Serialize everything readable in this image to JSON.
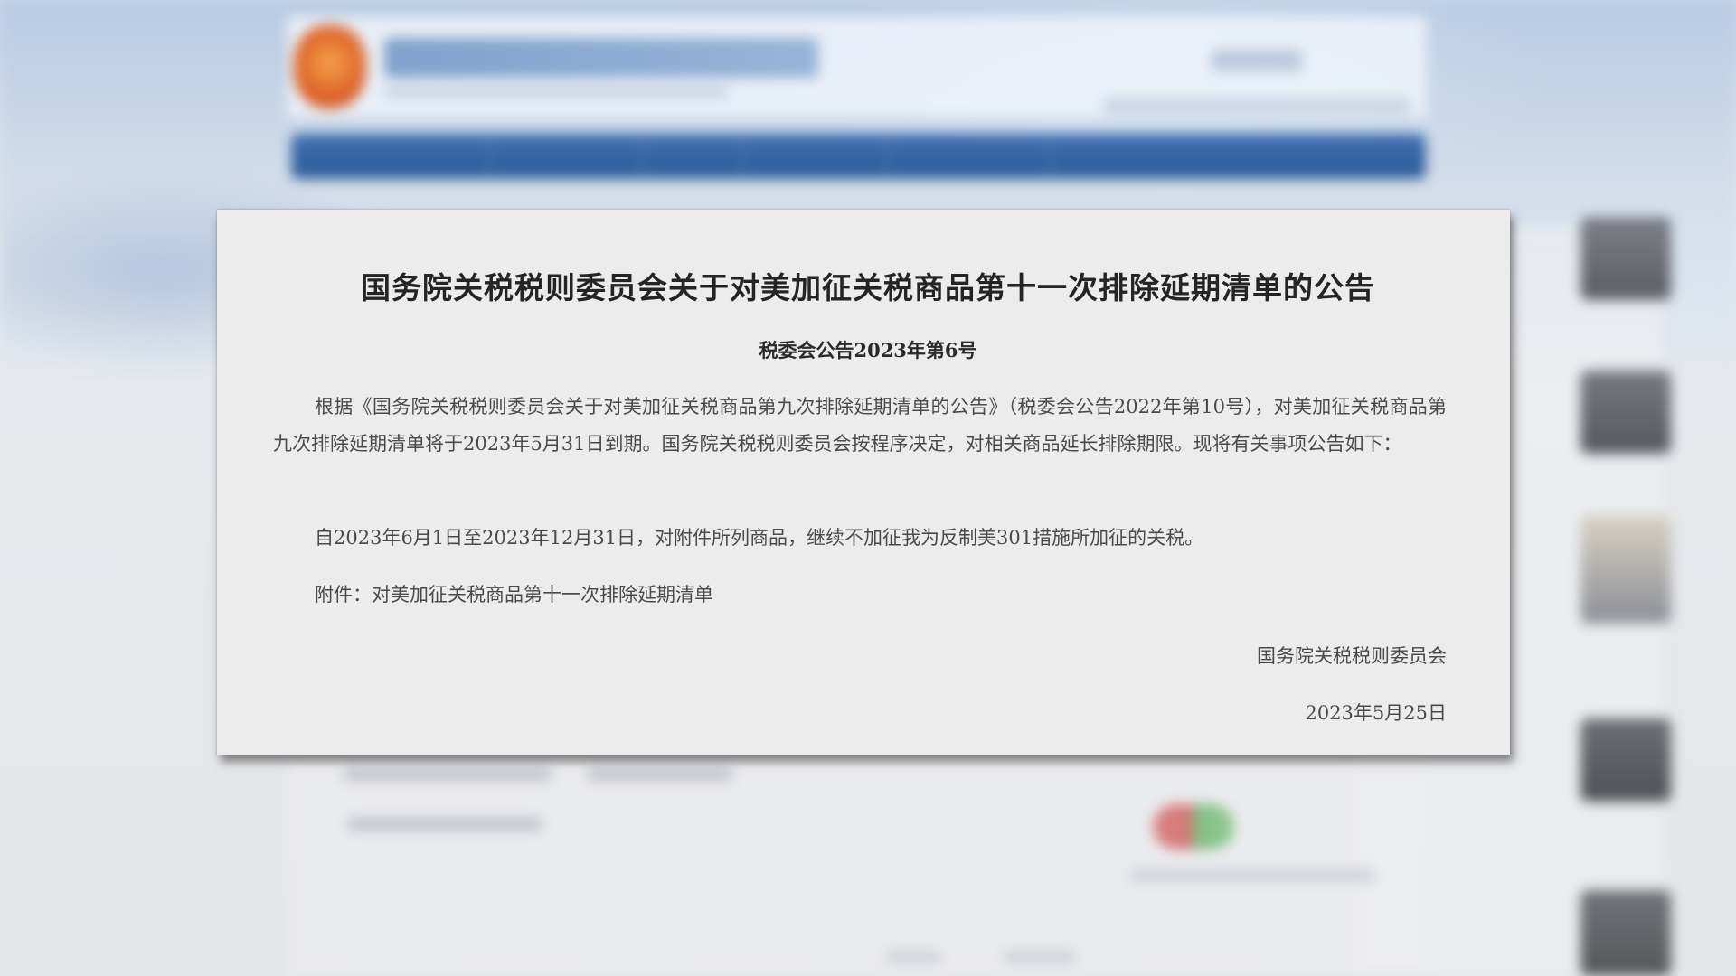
{
  "announcement": {
    "title": "国务院关税税则委员会关于对美加征关税商品第十一次排除延期清单的公告",
    "doc_number": "税委会公告2023年第6号",
    "paragraphs": [
      "根据《国务院关税税则委员会关于对美加征关税商品第九次排除延期清单的公告》（税委会公告2022年第10号），对美加征关税商品第九次排除延期清单将于2023年5月31日到期。国务院关税税则委员会按程序决定，对相关商品延长排除期限。现将有关事项公告如下：",
      "自2023年6月1日至2023年12月31日，对附件所列商品，继续不加征我为反制美301措施所加征的关税。",
      "附件：对美加征关税商品第十一次排除延期清单"
    ],
    "issuer": "国务院关税税则委员会",
    "date": "2023年5月25日"
  },
  "colors": {
    "nav_bar": "#2d5a98",
    "emblem": "#e0662c",
    "card_background": "#ececec",
    "title_text": "#242424",
    "body_text": "#4a4a4a"
  }
}
